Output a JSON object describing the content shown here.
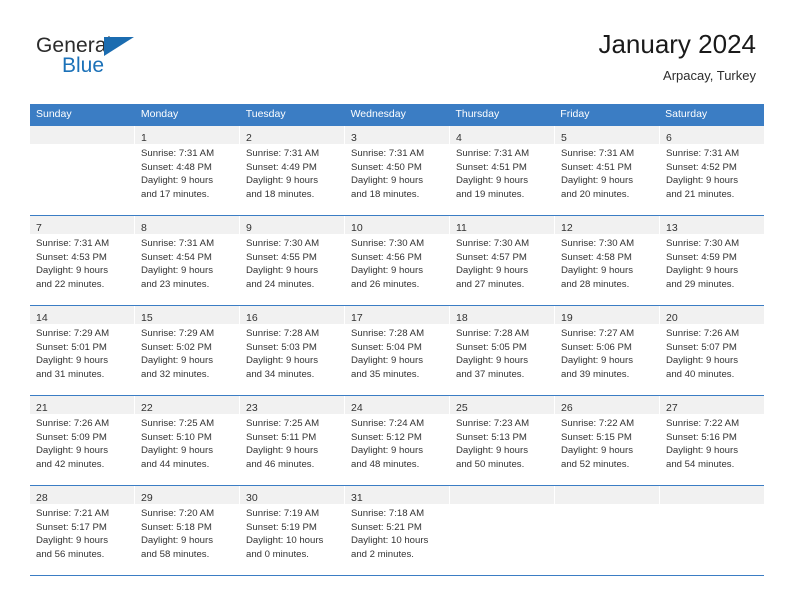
{
  "brand": {
    "name_top": "General",
    "name_bottom": "Blue",
    "flag_icon": "triangle-flag-icon",
    "accent_color": "#1b6cb0"
  },
  "header": {
    "title": "January 2024",
    "location": "Arpacay, Turkey"
  },
  "calendar": {
    "header_color": "#3b7dc4",
    "weekdays": [
      "Sunday",
      "Monday",
      "Tuesday",
      "Wednesday",
      "Thursday",
      "Friday",
      "Saturday"
    ],
    "weeks": [
      [
        {
          "day": "",
          "lines": []
        },
        {
          "day": "1",
          "lines": [
            "Sunrise: 7:31 AM",
            "Sunset: 4:48 PM",
            "Daylight: 9 hours",
            "and 17 minutes."
          ]
        },
        {
          "day": "2",
          "lines": [
            "Sunrise: 7:31 AM",
            "Sunset: 4:49 PM",
            "Daylight: 9 hours",
            "and 18 minutes."
          ]
        },
        {
          "day": "3",
          "lines": [
            "Sunrise: 7:31 AM",
            "Sunset: 4:50 PM",
            "Daylight: 9 hours",
            "and 18 minutes."
          ]
        },
        {
          "day": "4",
          "lines": [
            "Sunrise: 7:31 AM",
            "Sunset: 4:51 PM",
            "Daylight: 9 hours",
            "and 19 minutes."
          ]
        },
        {
          "day": "5",
          "lines": [
            "Sunrise: 7:31 AM",
            "Sunset: 4:51 PM",
            "Daylight: 9 hours",
            "and 20 minutes."
          ]
        },
        {
          "day": "6",
          "lines": [
            "Sunrise: 7:31 AM",
            "Sunset: 4:52 PM",
            "Daylight: 9 hours",
            "and 21 minutes."
          ]
        }
      ],
      [
        {
          "day": "7",
          "lines": [
            "Sunrise: 7:31 AM",
            "Sunset: 4:53 PM",
            "Daylight: 9 hours",
            "and 22 minutes."
          ]
        },
        {
          "day": "8",
          "lines": [
            "Sunrise: 7:31 AM",
            "Sunset: 4:54 PM",
            "Daylight: 9 hours",
            "and 23 minutes."
          ]
        },
        {
          "day": "9",
          "lines": [
            "Sunrise: 7:30 AM",
            "Sunset: 4:55 PM",
            "Daylight: 9 hours",
            "and 24 minutes."
          ]
        },
        {
          "day": "10",
          "lines": [
            "Sunrise: 7:30 AM",
            "Sunset: 4:56 PM",
            "Daylight: 9 hours",
            "and 26 minutes."
          ]
        },
        {
          "day": "11",
          "lines": [
            "Sunrise: 7:30 AM",
            "Sunset: 4:57 PM",
            "Daylight: 9 hours",
            "and 27 minutes."
          ]
        },
        {
          "day": "12",
          "lines": [
            "Sunrise: 7:30 AM",
            "Sunset: 4:58 PM",
            "Daylight: 9 hours",
            "and 28 minutes."
          ]
        },
        {
          "day": "13",
          "lines": [
            "Sunrise: 7:30 AM",
            "Sunset: 4:59 PM",
            "Daylight: 9 hours",
            "and 29 minutes."
          ]
        }
      ],
      [
        {
          "day": "14",
          "lines": [
            "Sunrise: 7:29 AM",
            "Sunset: 5:01 PM",
            "Daylight: 9 hours",
            "and 31 minutes."
          ]
        },
        {
          "day": "15",
          "lines": [
            "Sunrise: 7:29 AM",
            "Sunset: 5:02 PM",
            "Daylight: 9 hours",
            "and 32 minutes."
          ]
        },
        {
          "day": "16",
          "lines": [
            "Sunrise: 7:28 AM",
            "Sunset: 5:03 PM",
            "Daylight: 9 hours",
            "and 34 minutes."
          ]
        },
        {
          "day": "17",
          "lines": [
            "Sunrise: 7:28 AM",
            "Sunset: 5:04 PM",
            "Daylight: 9 hours",
            "and 35 minutes."
          ]
        },
        {
          "day": "18",
          "lines": [
            "Sunrise: 7:28 AM",
            "Sunset: 5:05 PM",
            "Daylight: 9 hours",
            "and 37 minutes."
          ]
        },
        {
          "day": "19",
          "lines": [
            "Sunrise: 7:27 AM",
            "Sunset: 5:06 PM",
            "Daylight: 9 hours",
            "and 39 minutes."
          ]
        },
        {
          "day": "20",
          "lines": [
            "Sunrise: 7:26 AM",
            "Sunset: 5:07 PM",
            "Daylight: 9 hours",
            "and 40 minutes."
          ]
        }
      ],
      [
        {
          "day": "21",
          "lines": [
            "Sunrise: 7:26 AM",
            "Sunset: 5:09 PM",
            "Daylight: 9 hours",
            "and 42 minutes."
          ]
        },
        {
          "day": "22",
          "lines": [
            "Sunrise: 7:25 AM",
            "Sunset: 5:10 PM",
            "Daylight: 9 hours",
            "and 44 minutes."
          ]
        },
        {
          "day": "23",
          "lines": [
            "Sunrise: 7:25 AM",
            "Sunset: 5:11 PM",
            "Daylight: 9 hours",
            "and 46 minutes."
          ]
        },
        {
          "day": "24",
          "lines": [
            "Sunrise: 7:24 AM",
            "Sunset: 5:12 PM",
            "Daylight: 9 hours",
            "and 48 minutes."
          ]
        },
        {
          "day": "25",
          "lines": [
            "Sunrise: 7:23 AM",
            "Sunset: 5:13 PM",
            "Daylight: 9 hours",
            "and 50 minutes."
          ]
        },
        {
          "day": "26",
          "lines": [
            "Sunrise: 7:22 AM",
            "Sunset: 5:15 PM",
            "Daylight: 9 hours",
            "and 52 minutes."
          ]
        },
        {
          "day": "27",
          "lines": [
            "Sunrise: 7:22 AM",
            "Sunset: 5:16 PM",
            "Daylight: 9 hours",
            "and 54 minutes."
          ]
        }
      ],
      [
        {
          "day": "28",
          "lines": [
            "Sunrise: 7:21 AM",
            "Sunset: 5:17 PM",
            "Daylight: 9 hours",
            "and 56 minutes."
          ]
        },
        {
          "day": "29",
          "lines": [
            "Sunrise: 7:20 AM",
            "Sunset: 5:18 PM",
            "Daylight: 9 hours",
            "and 58 minutes."
          ]
        },
        {
          "day": "30",
          "lines": [
            "Sunrise: 7:19 AM",
            "Sunset: 5:19 PM",
            "Daylight: 10 hours",
            "and 0 minutes."
          ]
        },
        {
          "day": "31",
          "lines": [
            "Sunrise: 7:18 AM",
            "Sunset: 5:21 PM",
            "Daylight: 10 hours",
            "and 2 minutes."
          ]
        },
        {
          "day": "",
          "lines": []
        },
        {
          "day": "",
          "lines": []
        },
        {
          "day": "",
          "lines": []
        }
      ]
    ]
  }
}
